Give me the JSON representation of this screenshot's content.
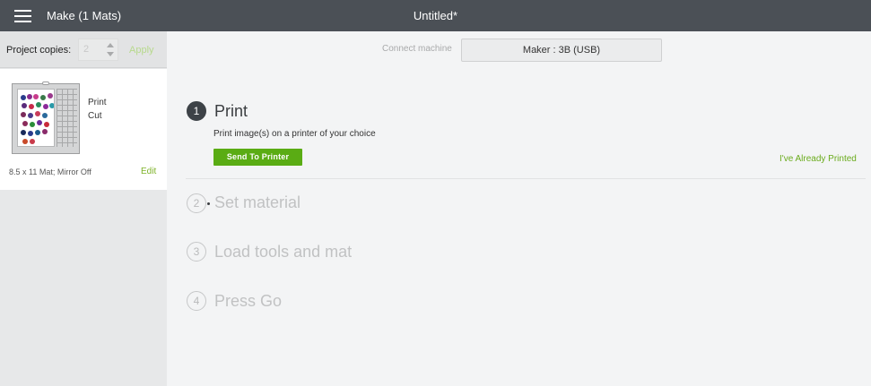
{
  "header": {
    "app_title": "Make (1 Mats)",
    "doc_title": "Untitled*"
  },
  "sidebar": {
    "copies_label": "Project copies:",
    "copies_value": "2",
    "apply_label": "Apply",
    "mat": {
      "line1": "Print",
      "line2": "Cut",
      "description": "8.5 x 11 Mat; Mirror Off",
      "edit_label": "Edit"
    }
  },
  "machine": {
    "connect_label": "Connect machine",
    "selected": "Maker : 3B (USB)"
  },
  "steps": [
    {
      "number": "1",
      "title": "Print",
      "state": "active"
    },
    {
      "number": "2",
      "title": "Set material",
      "state": "inactive"
    },
    {
      "number": "3",
      "title": "Load tools and mat",
      "state": "inactive"
    },
    {
      "number": "4",
      "title": "Press Go",
      "state": "inactive"
    }
  ],
  "print_step": {
    "description": "Print image(s) on a printer of your choice",
    "send_button": "Send To Printer",
    "already_printed": "I've Already Printed"
  },
  "colors": {
    "topbar": "#4b5056",
    "accent_green": "#5aac14",
    "link_green": "#6aab1c"
  }
}
